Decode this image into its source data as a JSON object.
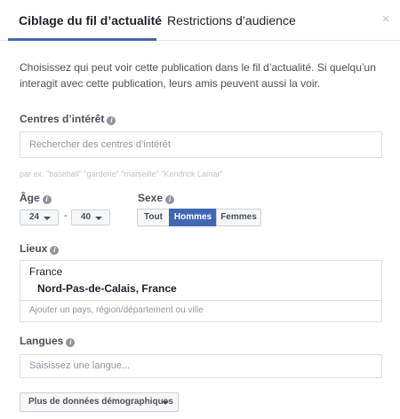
{
  "tabs": {
    "active": "Ciblage du fil d’actualité",
    "inactive": "Restrictions d’audience",
    "close": "×"
  },
  "intro": "Choisissez qui peut voir cette publication dans le fil d’actualité. Si quelqu’un interagit avec cette publication, leurs amis peuvent aussi la voir.",
  "interests": {
    "label": "Centres d’intérêt",
    "placeholder": "Rechercher des centres d’intérêt",
    "hint": "par ex. \"baseball\" \"garderie\" \"marseille\" \"Kendrick Lamar\""
  },
  "age": {
    "label": "Âge",
    "min": "24",
    "separator": "-",
    "max": "40"
  },
  "gender": {
    "label": "Sexe",
    "options": [
      "Tout",
      "Hommes",
      "Femmes"
    ],
    "selected": "Hommes"
  },
  "locations": {
    "label": "Lieux",
    "country": "France",
    "region": "Nord-Pas-de-Calais, France",
    "placeholder": "Ajouter un pays, région/département ou ville"
  },
  "languages": {
    "label": "Langues",
    "placeholder": "Saisissez une langue..."
  },
  "demographics_button": "Plus de données démographiques",
  "info_icon_glyph": "i",
  "colors": {
    "accent": "#4267b2",
    "text": "#1d2129",
    "muted": "#90949c"
  }
}
